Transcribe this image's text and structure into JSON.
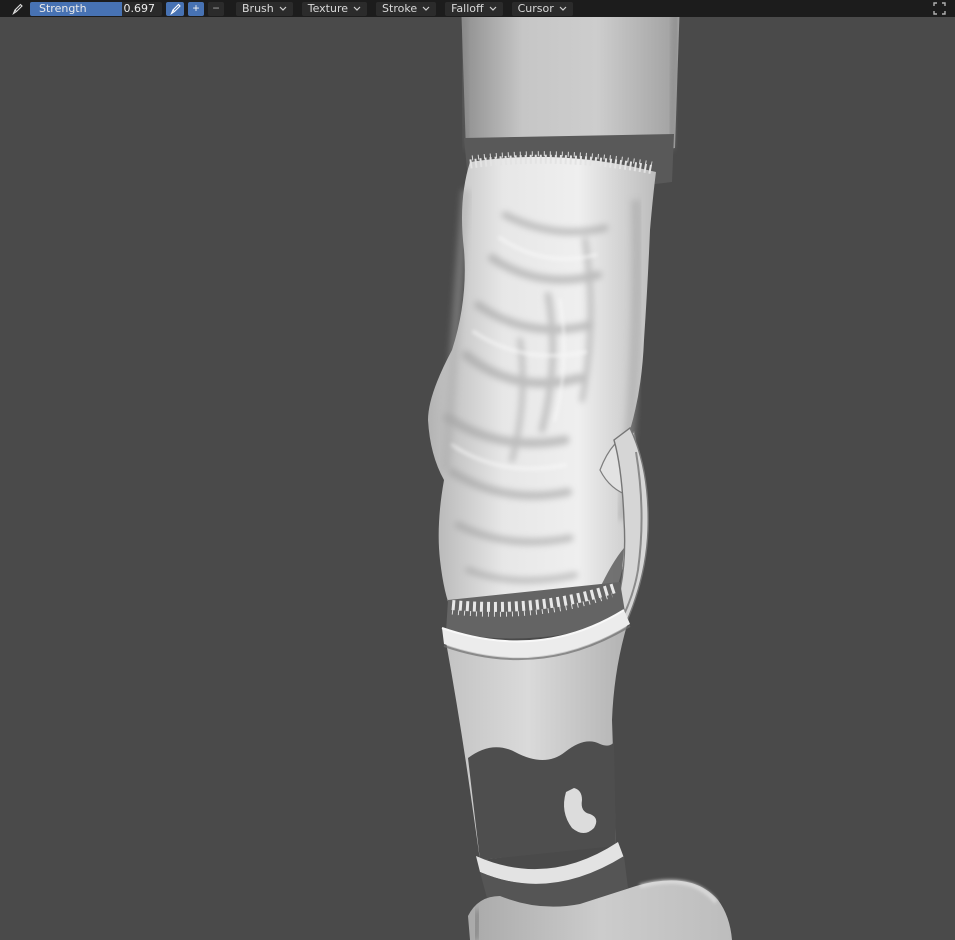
{
  "header": {
    "strength_label": "Strength",
    "strength_value": "0.697",
    "strength_fraction": 0.697,
    "plus": "+",
    "minus": "−",
    "dropdowns": [
      {
        "label": "Brush"
      },
      {
        "label": "Texture"
      },
      {
        "label": "Stroke"
      },
      {
        "label": "Falloff"
      },
      {
        "label": "Cursor"
      }
    ]
  },
  "colors": {
    "accent": "#4772b3",
    "header_bg": "#1c1c1c",
    "viewport_bg": "#4a4a4a"
  }
}
